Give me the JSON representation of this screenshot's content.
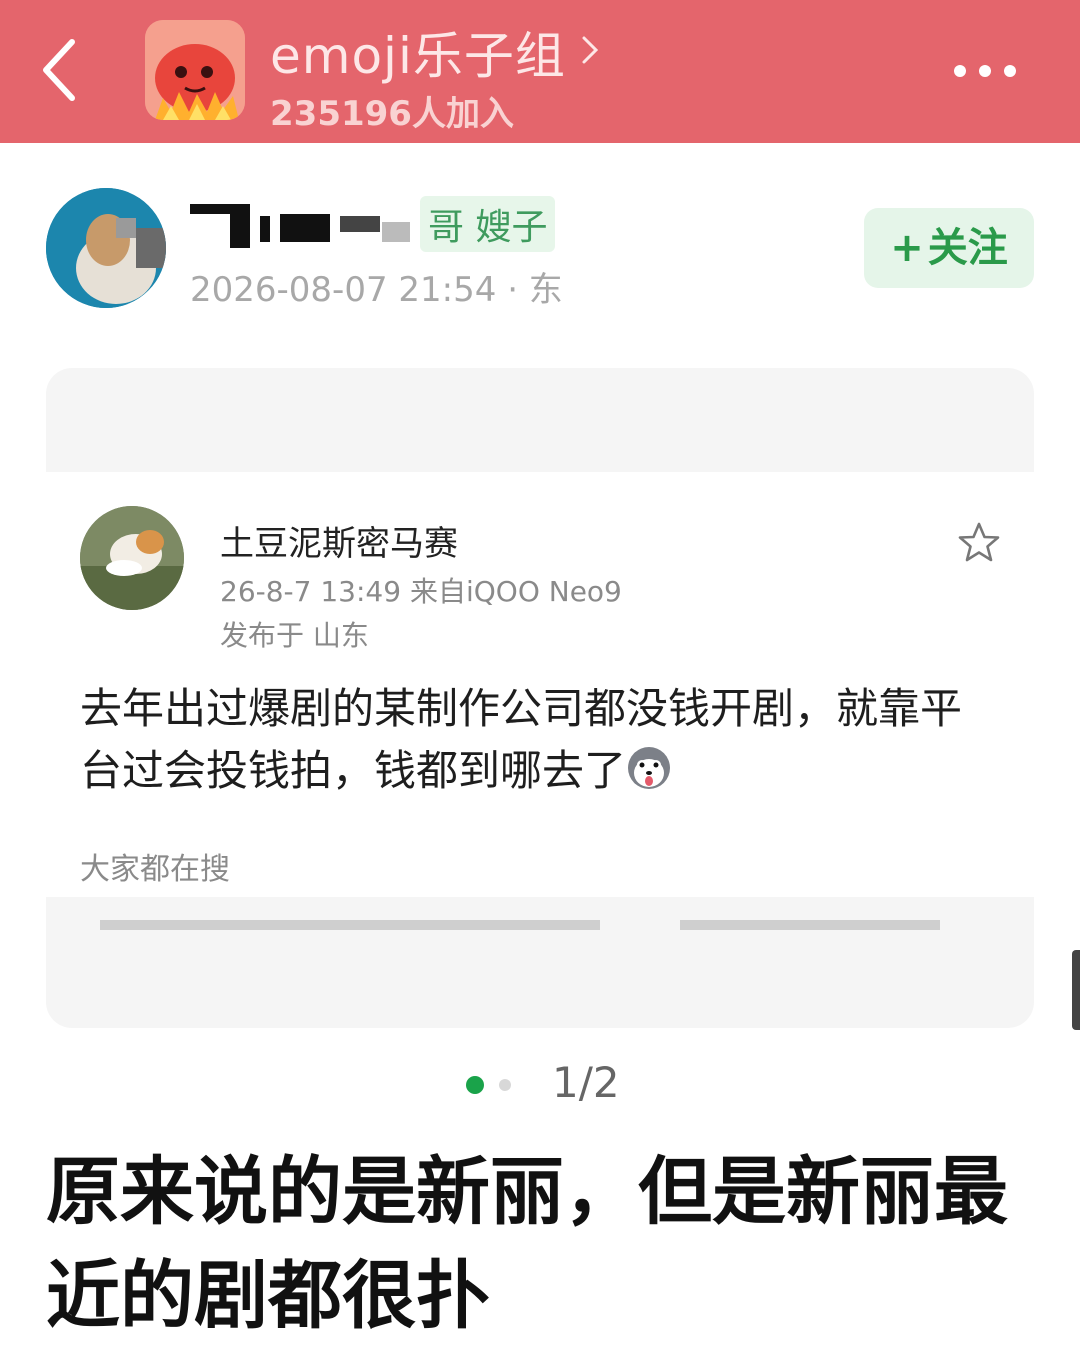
{
  "header": {
    "group_name": "emoji乐子组",
    "members": "235196人加入"
  },
  "author": {
    "tag": "哥 嫂子",
    "meta": "2026-08-07 21:54 · 东",
    "follow_label": "关注",
    "follow_plus": "+"
  },
  "post": {
    "username": "土豆泥斯密马赛",
    "time": "26-8-7 13:49  来自iQOO Neo9",
    "location": "发布于 山东",
    "body": "去年出过爆剧的某制作公司都没钱开剧，就靠平台过会投钱拍，钱都到哪去了",
    "search_label": "大家都在搜"
  },
  "pager": {
    "counter": "1/2"
  },
  "caption": "原来说的是新丽，但是新丽最近的剧都很扑",
  "colors": {
    "header_bg": "#e4656c",
    "accent_green": "#2a9a4a"
  }
}
